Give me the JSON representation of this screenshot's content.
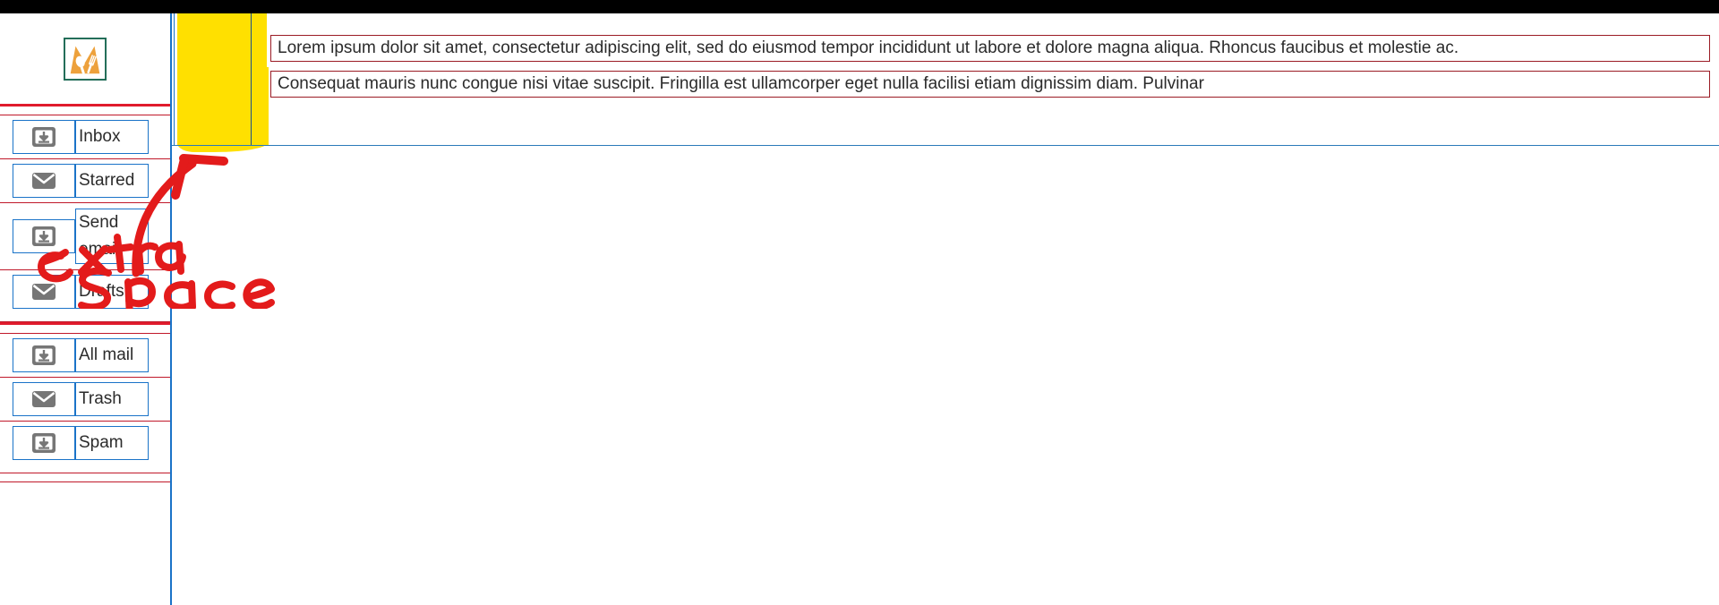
{
  "window": {
    "title_bar_color": "#000000"
  },
  "theme": {
    "accent_blue": "#1a73c8",
    "rule_red": "#e01b2c",
    "box_red": "#9b1b24",
    "highlight_yellow": "#ffe000",
    "logo_orange": "#eda13c",
    "annotation_red": "#e31b1b"
  },
  "sidebar": {
    "logo": {
      "name": "meal-app-logo",
      "description": "orange M with spoon and fork"
    },
    "items": [
      {
        "label": "Inbox",
        "icon": "download-box-icon"
      },
      {
        "label": "Starred",
        "icon": "envelope-icon"
      },
      {
        "label": "Send email",
        "icon": "download-box-icon",
        "line1": "Send",
        "line2": "email"
      },
      {
        "label": "Drafts",
        "icon": "envelope-icon"
      },
      {
        "label": "All mail",
        "icon": "download-box-icon"
      },
      {
        "label": "Trash",
        "icon": "envelope-icon"
      },
      {
        "label": "Spam",
        "icon": "download-box-icon"
      }
    ]
  },
  "main": {
    "messages": [
      "Lorem ipsum dolor sit amet, consectetur adipiscing elit, sed do eiusmod tempor incididunt ut labore et dolore magna aliqua. Rhoncus faucibus et molestie ac.",
      "Consequat mauris nunc congue nisi vitae suscipit. Fringilla est ullamcorper eget nulla facilisi etiam dignissim diam. Pulvinar"
    ]
  },
  "annotation": {
    "text_line1": "extra",
    "text_line2": "Space",
    "arrow": "curved-up-arrow"
  }
}
